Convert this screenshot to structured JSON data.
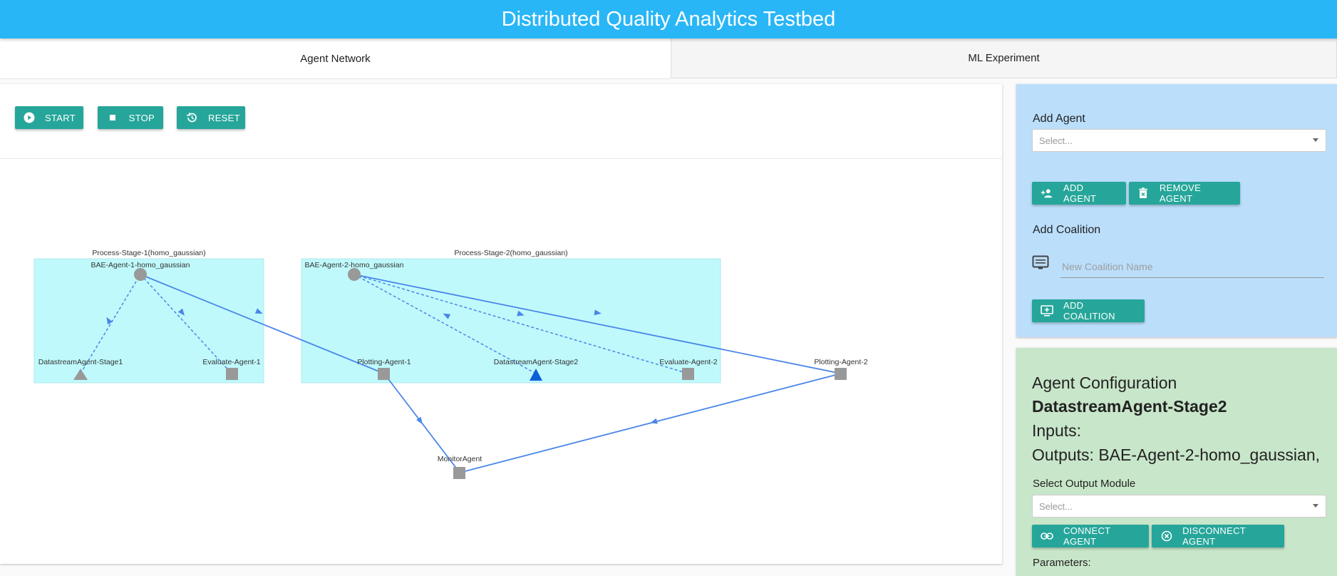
{
  "app": {
    "title": "Distributed Quality Analytics Testbed"
  },
  "tabs": [
    {
      "label": "Agent Network",
      "active": true
    },
    {
      "label": "ML Experiment",
      "active": false
    }
  ],
  "toolbar": {
    "start_label": "START",
    "stop_label": "STOP",
    "reset_label": "RESET"
  },
  "graph": {
    "groups": [
      {
        "label": "Process-Stage-1(homo_gaussian)"
      },
      {
        "label": "Process-Stage-2(homo_gaussian)"
      }
    ],
    "nodes": [
      {
        "id": "bae1",
        "label": "BAE-Agent-1-homo_gaussian",
        "shape": "circle"
      },
      {
        "id": "ds1",
        "label": "DatastreamAgent-Stage1",
        "shape": "triangle"
      },
      {
        "id": "ev1",
        "label": "Evaluate-Agent-1",
        "shape": "square"
      },
      {
        "id": "bae2",
        "label": "BAE-Agent-2-homo_gaussian",
        "shape": "circle"
      },
      {
        "id": "pl1",
        "label": "Plotting-Agent-1",
        "shape": "square"
      },
      {
        "id": "ds2",
        "label": "DatastreamAgent-Stage2",
        "shape": "triangle",
        "selected": true
      },
      {
        "id": "ev2",
        "label": "Evaluate-Agent-2",
        "shape": "square"
      },
      {
        "id": "pl2",
        "label": "Plotting-Agent-2",
        "shape": "square"
      },
      {
        "id": "mon",
        "label": "MonitorAgent",
        "shape": "square"
      }
    ],
    "edges": [
      {
        "from": "ds1",
        "to": "bae1",
        "style": "dashed"
      },
      {
        "from": "bae1",
        "to": "ev1",
        "style": "dashed"
      },
      {
        "from": "bae1",
        "to": "pl1",
        "style": "solid"
      },
      {
        "from": "ds2",
        "to": "bae2",
        "style": "dashed"
      },
      {
        "from": "bae2",
        "to": "ev2",
        "style": "dashed"
      },
      {
        "from": "bae2",
        "to": "pl2",
        "style": "solid"
      },
      {
        "from": "pl1",
        "to": "mon",
        "style": "solid"
      },
      {
        "from": "pl2",
        "to": "mon",
        "style": "solid"
      }
    ],
    "colors": {
      "group_fill": "#bff9fb",
      "node": "#999999",
      "node_selected": "#0d5fd8",
      "edge": "#4a86e8"
    }
  },
  "add_agent": {
    "label": "Add Agent",
    "select_placeholder": "Select...",
    "add_label": "ADD AGENT",
    "remove_label": "REMOVE AGENT"
  },
  "add_coalition": {
    "label": "Add Coalition",
    "input_placeholder": "New Coalition Name",
    "button_label": "ADD COALITION"
  },
  "agent_config": {
    "title": "Agent Configuration",
    "agent_name": "DatastreamAgent-Stage2",
    "inputs_text": "Inputs:",
    "outputs_text": "Outputs: BAE-Agent-2-homo_gaussian,",
    "select_output_label": "Select Output Module",
    "select_placeholder": "Select...",
    "connect_label": "CONNECT AGENT",
    "disconnect_label": "DISCONNECT AGENT",
    "parameters_label": "Parameters:"
  },
  "accent": "#26a69a"
}
